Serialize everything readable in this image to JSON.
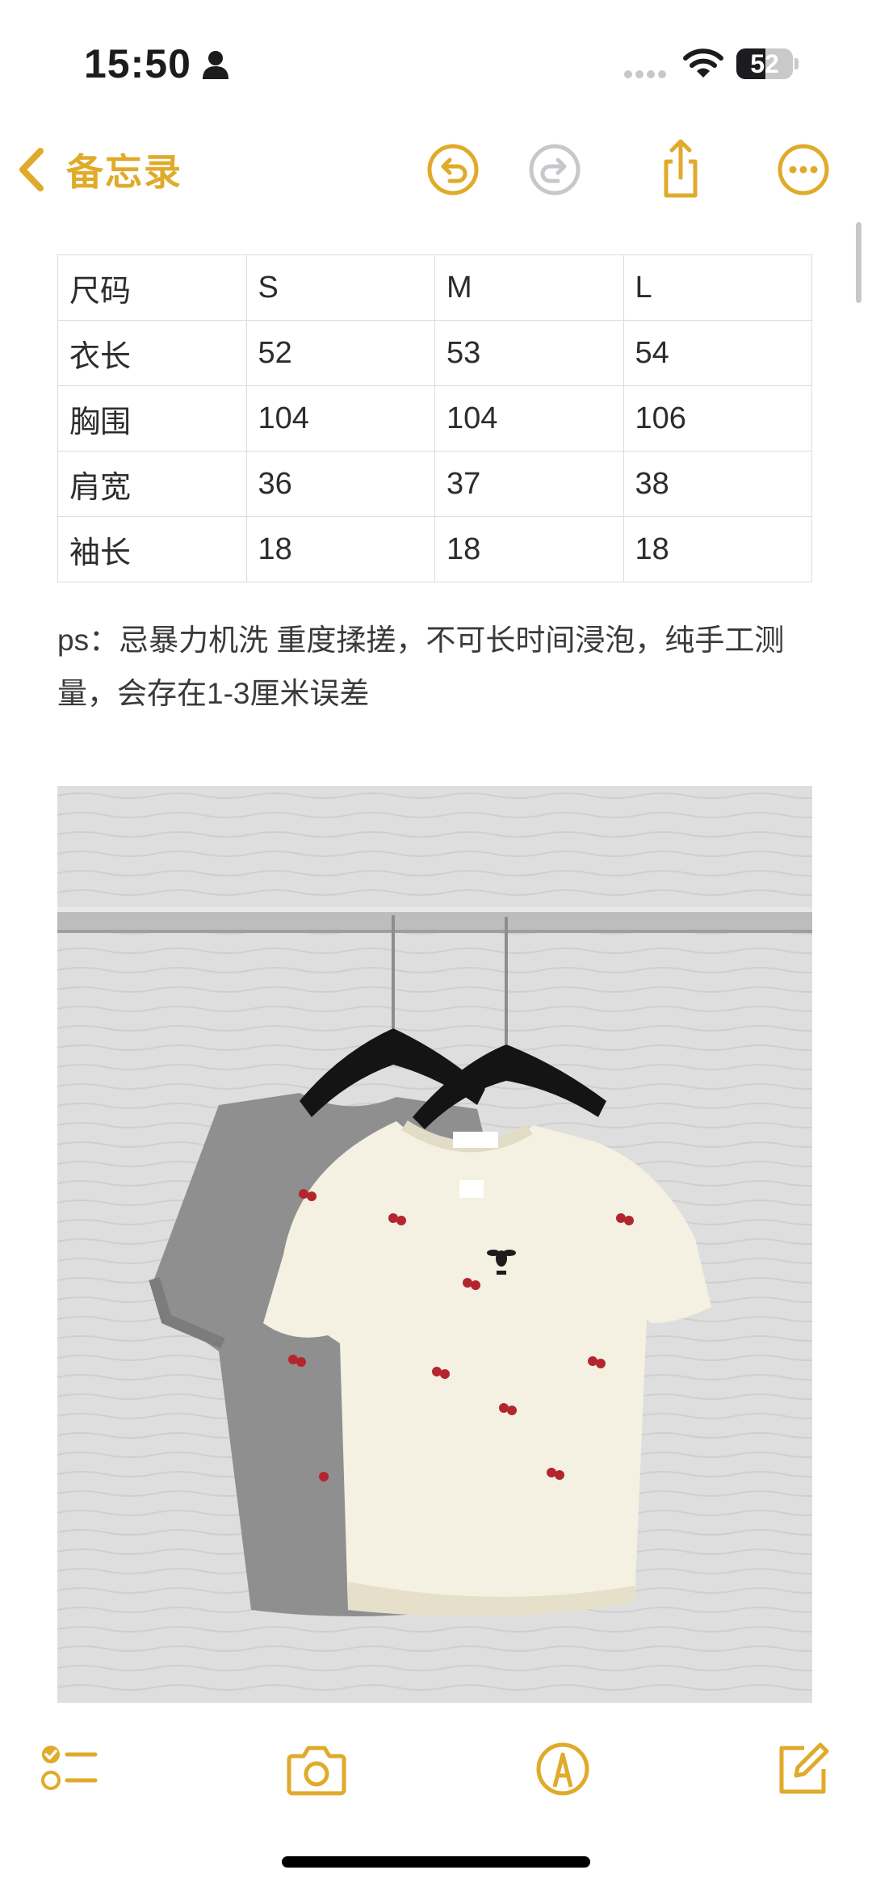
{
  "status_bar": {
    "time": "15:50",
    "battery_level": "52",
    "icons": [
      "person-icon",
      "signal-dots-icon",
      "wifi-icon",
      "battery-icon"
    ]
  },
  "nav": {
    "back_label": "备忘录",
    "icons": [
      "back-chevron-icon",
      "undo-icon",
      "redo-icon",
      "share-icon",
      "more-icon"
    ]
  },
  "colors": {
    "accent": "#e0aa2a",
    "disabled": "#c7c7cc"
  },
  "size_table": {
    "rows": [
      [
        "尺码",
        "S",
        "M",
        "L"
      ],
      [
        "衣长",
        "52",
        "53",
        "54"
      ],
      [
        "胸围",
        "104",
        "104",
        "106"
      ],
      [
        "肩宽",
        "36",
        "37",
        "38"
      ],
      [
        "袖长",
        "18",
        "18",
        "18"
      ]
    ]
  },
  "note": {
    "text": "ps：忌暴力机洗 重度揉搓，不可长时间浸泡，纯手工测量，会存在1-3厘米误差"
  },
  "toolbar": {
    "icons": [
      "checklist-icon",
      "camera-icon",
      "markup-icon",
      "compose-icon"
    ]
  }
}
